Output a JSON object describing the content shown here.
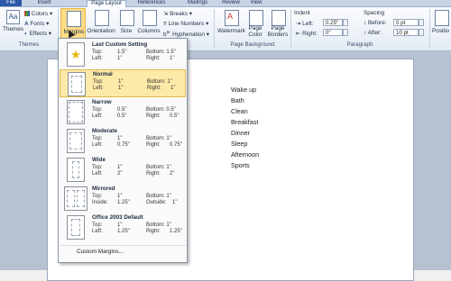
{
  "tabs": {
    "file": "File",
    "insert": "Insert",
    "page_layout": "Page Layout",
    "references": "References",
    "mailings": "Mailings",
    "review": "Review",
    "view": "View"
  },
  "ribbon": {
    "themes": {
      "label": "Themes",
      "colors": "Colors",
      "fonts": "Fonts",
      "effects": "Effects",
      "group": "Themes"
    },
    "page_setup": {
      "margins": "Margins",
      "orientation": "Orientation",
      "size": "Size",
      "columns": "Columns",
      "breaks": "Breaks",
      "line_numbers": "Line Numbers",
      "hyphenation": "Hyphenation"
    },
    "page_background": {
      "watermark": "Watermark",
      "page_color": "Page\nColor",
      "page_borders": "Page\nBorders",
      "group": "Page Background"
    },
    "paragraph": {
      "indent": "Indent",
      "left_label": "Left:",
      "left_value": "0.25\"",
      "right_label": "Right:",
      "right_value": "0\"",
      "spacing": "Spacing",
      "before_label": "Before:",
      "before_value": "0 pt",
      "after_label": "After:",
      "after_value": "10 pt",
      "group": "Paragraph"
    },
    "position": "Positio"
  },
  "document": {
    "lines": [
      "Wake up",
      "Bath",
      "Clean",
      "Breakfast",
      "Dinner",
      "Sleep",
      "Afternoon",
      "Sports"
    ]
  },
  "margins_menu": {
    "items": [
      {
        "name": "Last Custom Setting",
        "r1": [
          "Top:",
          "1.5\"",
          "Bottom: 1.5\""
        ],
        "r2": [
          "Left:",
          "1\"",
          "Right:",
          "1\""
        ]
      },
      {
        "name": "Normal",
        "r1": [
          "Top:",
          "1\"",
          "Bottom: 1\""
        ],
        "r2": [
          "Left:",
          "1\"",
          "Right:",
          "1\""
        ]
      },
      {
        "name": "Narrow",
        "r1": [
          "Top:",
          "0.5\"",
          "Bottom: 0.5\""
        ],
        "r2": [
          "Left:",
          "0.5\"",
          "Right:",
          "0.5\""
        ]
      },
      {
        "name": "Moderate",
        "r1": [
          "Top:",
          "1\"",
          "Bottom: 1\""
        ],
        "r2": [
          "Left:",
          "0.75\"",
          "Right:",
          "0.75\""
        ]
      },
      {
        "name": "Wide",
        "r1": [
          "Top:",
          "1\"",
          "Bottom: 1\""
        ],
        "r2": [
          "Left:",
          "2\"",
          "Right:",
          "2\""
        ]
      },
      {
        "name": "Mirrored",
        "r1": [
          "Top:",
          "1\"",
          "Bottom: 1\""
        ],
        "r2": [
          "Inside:",
          "1.25\"",
          "Outside:",
          "1\""
        ]
      },
      {
        "name": "Office 2003 Default",
        "r1": [
          "Top:",
          "1\"",
          "Bottom: 1\""
        ],
        "r2": [
          "Left:",
          "1.25\"",
          "Right:",
          "1.25\""
        ]
      }
    ],
    "custom": "Custom Margins..."
  }
}
